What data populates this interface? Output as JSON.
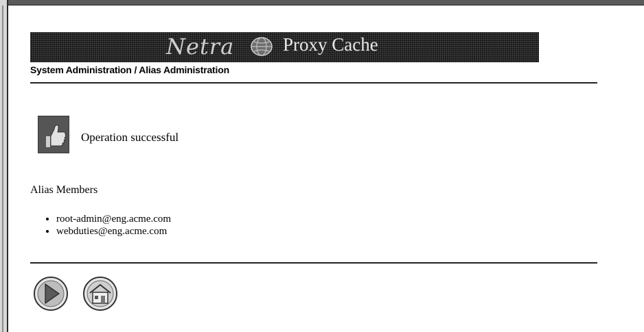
{
  "banner": {
    "brand": "Netra",
    "product": "Proxy Cache"
  },
  "breadcrumb": "System Administration / Alias Administration",
  "status": {
    "message": "Operation successful"
  },
  "alias": {
    "title": "Alias Members",
    "members": [
      "root-admin@eng.acme.com",
      "webduties@eng.acme.com"
    ]
  },
  "icons": {
    "success": "thumbs-up-icon",
    "next": "right-arrow-icon",
    "home": "home-icon"
  },
  "colors": {
    "banner_bg": "#1a1a1a",
    "text": "#000000"
  }
}
